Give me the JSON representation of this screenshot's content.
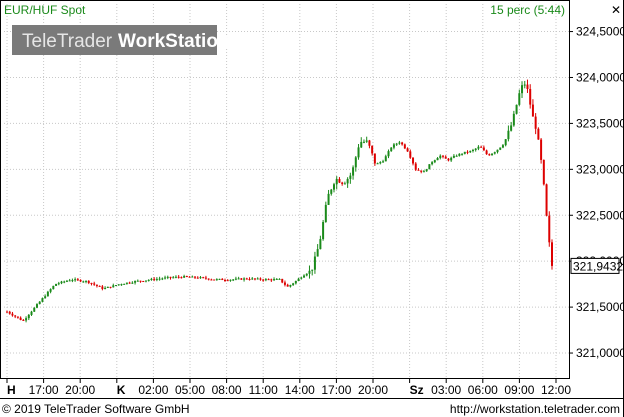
{
  "header": {
    "symbol": "EUR/HUF Spot",
    "interval": "15 perc (5:44)"
  },
  "watermark": {
    "text_a": "TeleTrader",
    "text_b": "WorkStation"
  },
  "footer": {
    "copyright": "© 2019 TeleTrader Software GmbH",
    "url": "http://workstation.teletrader.com"
  },
  "colors": {
    "up": "#1a8a1a",
    "down": "#dd0000",
    "grid": "#c8c8c8",
    "text_green": "#1a8a1a"
  },
  "chart_data": {
    "type": "candlestick",
    "title": "EUR/HUF Spot",
    "y_ticks": [
      "321,0000",
      "321,5000",
      "322,0000",
      "322,5000",
      "323,0000",
      "323,5000",
      "324,0000",
      "324,5000"
    ],
    "ylim": [
      320.75,
      324.8
    ],
    "last_value_label": "321,9432",
    "last_value": 321.9432,
    "x_ticks": [
      {
        "label": "H",
        "day": true
      },
      {
        "label": "17:00"
      },
      {
        "label": "20:00"
      },
      {
        "label": "K",
        "day": true
      },
      {
        "label": "02:00"
      },
      {
        "label": "05:00"
      },
      {
        "label": "08:00"
      },
      {
        "label": "11:00"
      },
      {
        "label": "14:00"
      },
      {
        "label": "17:00"
      },
      {
        "label": "20:00"
      },
      {
        "label": "Sz",
        "day": true
      },
      {
        "label": "03:00"
      },
      {
        "label": "06:00"
      },
      {
        "label": "09:00"
      },
      {
        "label": "12:00"
      }
    ],
    "price_path": [
      [
        0,
        321.45
      ],
      [
        4,
        321.35
      ],
      [
        8,
        321.55
      ],
      [
        12,
        321.75
      ],
      [
        16,
        321.8
      ],
      [
        20,
        321.78
      ],
      [
        24,
        321.7
      ],
      [
        28,
        321.75
      ],
      [
        32,
        321.78
      ],
      [
        36,
        321.8
      ],
      [
        40,
        321.82
      ],
      [
        44,
        321.83
      ],
      [
        48,
        321.82
      ],
      [
        52,
        321.8
      ],
      [
        56,
        321.8
      ],
      [
        60,
        321.81
      ],
      [
        64,
        321.8
      ],
      [
        68,
        321.8
      ],
      [
        70,
        321.72
      ],
      [
        72,
        321.78
      ],
      [
        74,
        321.85
      ],
      [
        76,
        321.9
      ],
      [
        78,
        322.2
      ],
      [
        80,
        322.7
      ],
      [
        82,
        322.9
      ],
      [
        84,
        322.85
      ],
      [
        86,
        322.95
      ],
      [
        88,
        323.3
      ],
      [
        90,
        323.3
      ],
      [
        92,
        323.05
      ],
      [
        94,
        323.1
      ],
      [
        96,
        323.25
      ],
      [
        98,
        323.3
      ],
      [
        100,
        323.2
      ],
      [
        102,
        323.0
      ],
      [
        104,
        322.97
      ],
      [
        106,
        323.08
      ],
      [
        108,
        323.15
      ],
      [
        110,
        323.1
      ],
      [
        112,
        323.15
      ],
      [
        114,
        323.18
      ],
      [
        116,
        323.2
      ],
      [
        118,
        323.25
      ],
      [
        120,
        323.15
      ],
      [
        122,
        323.2
      ],
      [
        124,
        323.28
      ],
      [
        126,
        323.5
      ],
      [
        128,
        323.85
      ],
      [
        129,
        323.95
      ],
      [
        130,
        323.85
      ],
      [
        131,
        323.6
      ],
      [
        132,
        323.45
      ],
      [
        133,
        323.2
      ],
      [
        134,
        322.8
      ],
      [
        135,
        322.3
      ],
      [
        136,
        321.95
      ]
    ]
  }
}
